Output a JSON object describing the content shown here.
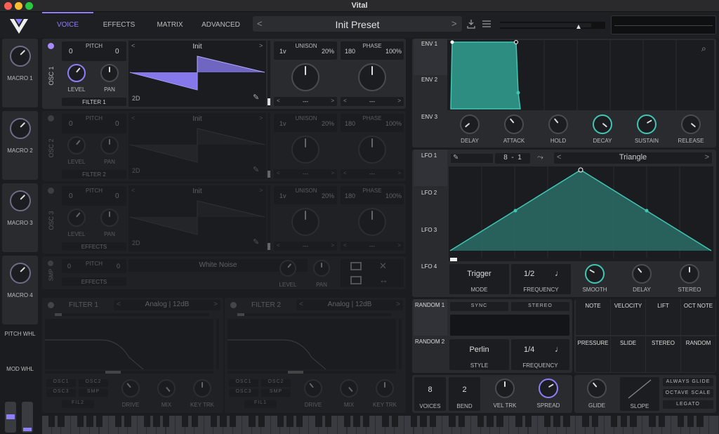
{
  "app": {
    "title": "Vital"
  },
  "tabs": [
    "VOICE",
    "EFFECTS",
    "MATRIX",
    "ADVANCED"
  ],
  "preset": {
    "name": "Init Preset",
    "prev": "<",
    "next": ">"
  },
  "macros": [
    "MACRO 1",
    "MACRO 2",
    "MACRO 3",
    "MACRO 4"
  ],
  "wheels": [
    "PITCH WHL",
    "MOD WHL"
  ],
  "osc": [
    {
      "name": "OSC 1",
      "pitch_label": "PITCH",
      "pitch_left": "0",
      "pitch_right": "0",
      "level": "LEVEL",
      "pan": "PAN",
      "route": "FILTER 1",
      "wave": "Init",
      "mode": "2D",
      "unison_label": "UNISON",
      "unison_left": "1v",
      "unison_right": "20%",
      "phase_label": "PHASE",
      "phase_left": "180",
      "phase_right": "100%",
      "unison_sel": "---",
      "phase_sel": "---"
    },
    {
      "name": "OSC 2",
      "pitch_label": "PITCH",
      "pitch_left": "0",
      "pitch_right": "0",
      "level": "LEVEL",
      "pan": "PAN",
      "route": "FILTER 2",
      "wave": "Init",
      "mode": "2D",
      "unison_label": "UNISON",
      "unison_left": "1v",
      "unison_right": "20%",
      "phase_label": "PHASE",
      "phase_left": "180",
      "phase_right": "100%",
      "unison_sel": "---",
      "phase_sel": "---"
    },
    {
      "name": "OSC 3",
      "pitch_label": "PITCH",
      "pitch_left": "0",
      "pitch_right": "0",
      "level": "LEVEL",
      "pan": "PAN",
      "route": "EFFECTS",
      "wave": "Init",
      "mode": "2D",
      "unison_label": "UNISON",
      "unison_left": "1v",
      "unison_right": "20%",
      "phase_label": "PHASE",
      "phase_left": "180",
      "phase_right": "100%",
      "unison_sel": "---",
      "phase_sel": "---"
    }
  ],
  "smp": {
    "name": "SMP",
    "pitch_label": "PITCH",
    "pitch_left": "0",
    "pitch_right": "0",
    "route": "EFFECTS",
    "sample": "White Noise",
    "level": "LEVEL",
    "pan": "PAN"
  },
  "filters": [
    {
      "name": "FILTER 1",
      "type": "Analog",
      "sub": "12dB",
      "drive": "DRIVE",
      "mix": "MIX",
      "key": "KEY TRK",
      "src": [
        "OSC1",
        "OSC2",
        "OSC3",
        "SMP"
      ],
      "route": "FIL2"
    },
    {
      "name": "FILTER 2",
      "type": "Analog",
      "sub": "12dB",
      "drive": "DRIVE",
      "mix": "MIX",
      "key": "KEY TRK",
      "src": [
        "OSC1",
        "OSC2",
        "OSC3",
        "SMP"
      ],
      "route": "FIL1"
    }
  ],
  "env": {
    "tabs": [
      "ENV 1",
      "ENV 2",
      "ENV 3"
    ],
    "knobs": [
      "DELAY",
      "ATTACK",
      "HOLD",
      "DECAY",
      "SUSTAIN",
      "RELEASE"
    ],
    "ticks": [
      "1s",
      "2s",
      "3s",
      "4s",
      "5s",
      "6s"
    ]
  },
  "lfo": {
    "tabs": [
      "LFO 1",
      "LFO 2",
      "LFO 3",
      "LFO 4"
    ],
    "div_left": "8",
    "div_sep": "-",
    "div_right": "1",
    "shape": "Triangle",
    "mode_value": "Trigger",
    "mode_label": "MODE",
    "freq_value": "1/2",
    "freq_label": "FREQUENCY",
    "knobs": [
      "SMOOTH",
      "DELAY",
      "STEREO"
    ]
  },
  "random": {
    "tabs": [
      "RANDOM 1",
      "RANDOM 2"
    ],
    "sync": "SYNC",
    "stereo": "STEREO",
    "style_value": "Perlin",
    "style_label": "STYLE",
    "freq_value": "1/4",
    "freq_label": "FREQUENCY"
  },
  "mod_sources": [
    "NOTE",
    "VELOCITY",
    "LIFT",
    "OCT NOTE",
    "PRESSURE",
    "SLIDE",
    "STEREO",
    "RANDOM"
  ],
  "voice": {
    "voices_value": "8",
    "voices_label": "VOICES",
    "bend_value": "2",
    "bend_label": "BEND",
    "veltrk": "VEL TRK",
    "spread": "SPREAD"
  },
  "glide": {
    "glide": "GLIDE",
    "slope": "SLOPE",
    "always": "ALWAYS GLIDE",
    "octave": "OCTAVE SCALE",
    "legato": "LEGATO"
  },
  "colors": {
    "accent": "#8c7ff7",
    "teal": "#40c6b3",
    "panel": "#2a2b2f",
    "bg": "#1b1c1f"
  }
}
